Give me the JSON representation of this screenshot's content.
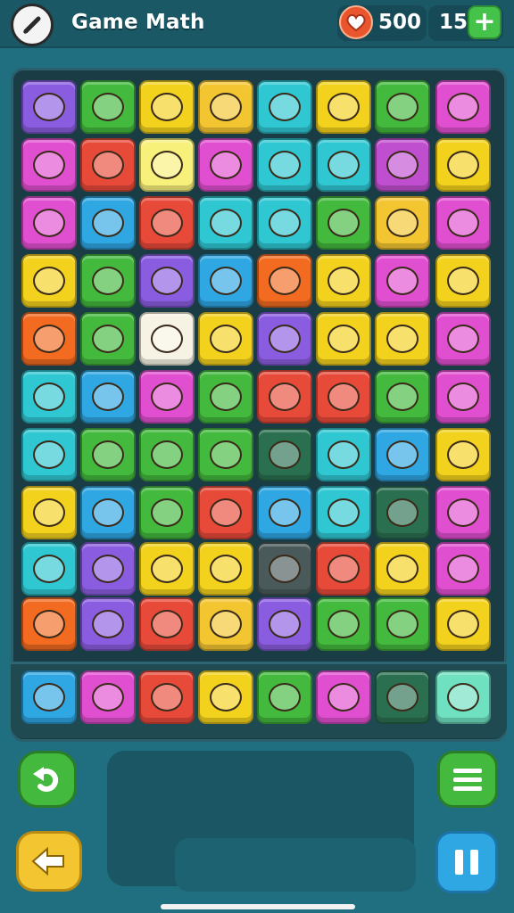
{
  "header": {
    "title": "Game Math",
    "hearts": "500",
    "coins": "15",
    "add_label": "+"
  },
  "colors": {
    "background": "#1f6f80",
    "board": "#1a3c44",
    "accent_green": "#43b93e",
    "accent_yellow": "#f3c531",
    "accent_blue": "#2fa7e3",
    "heart_red": "#e9552c"
  },
  "board": {
    "rows": [
      [
        {
          "color": "#8a5de0",
          "icon": "ghost-face"
        },
        {
          "color": "#43b93e",
          "icon": "leaf"
        },
        {
          "color": "#f3d21e",
          "icon": "star-flower"
        },
        {
          "color": "#f3c531",
          "icon": "sun-face"
        },
        {
          "color": "#2fc7d2",
          "icon": "frog-face"
        },
        {
          "color": "#f3d21e",
          "icon": "smiley"
        },
        {
          "color": "#43b93e",
          "icon": "smiley"
        },
        {
          "color": "#e04fd0",
          "icon": "crab"
        }
      ],
      [
        {
          "color": "#e04fd0",
          "icon": "cake"
        },
        {
          "color": "#e84a3a",
          "icon": "jar"
        },
        {
          "color": "#f7f07a",
          "icon": "ball"
        },
        {
          "color": "#e04fd0",
          "icon": "cup-face"
        },
        {
          "color": "#2fc7d2",
          "icon": "battery"
        },
        {
          "color": "#2fc7d2",
          "icon": "cat-face"
        },
        {
          "color": "#c04fd0",
          "icon": "robot"
        },
        {
          "color": "#f3d21e",
          "icon": "burger"
        }
      ],
      [
        {
          "color": "#e04fd0",
          "icon": "blob"
        },
        {
          "color": "#2fa7e3",
          "icon": "bottle"
        },
        {
          "color": "#e84a3a",
          "icon": "smiley"
        },
        {
          "color": "#2fc7d2",
          "icon": "shield"
        },
        {
          "color": "#2fc7d2",
          "icon": "orange"
        },
        {
          "color": "#43b93e",
          "icon": "tools"
        },
        {
          "color": "#f3c531",
          "icon": "lantern"
        },
        {
          "color": "#e04fd0",
          "icon": "fish"
        }
      ],
      [
        {
          "color": "#f3d21e",
          "icon": "mushroom"
        },
        {
          "color": "#43b93e",
          "icon": "flower"
        },
        {
          "color": "#8a5de0",
          "icon": "orange"
        },
        {
          "color": "#2fa7e3",
          "icon": "wrench"
        },
        {
          "color": "#f26b20",
          "icon": "tomato-face"
        },
        {
          "color": "#f3d21e",
          "icon": "leaf"
        },
        {
          "color": "#e04fd0",
          "icon": "shell"
        },
        {
          "color": "#f3d21e",
          "icon": "ball-face"
        }
      ],
      [
        {
          "color": "#f26b20",
          "icon": "smiley"
        },
        {
          "color": "#43b93e",
          "icon": "cookie"
        },
        {
          "color": "#f7f3e4",
          "icon": "gear-face"
        },
        {
          "color": "#f3d21e",
          "icon": "mouth"
        },
        {
          "color": "#8a5de0",
          "icon": "plum"
        },
        {
          "color": "#f3d21e",
          "icon": "dots"
        },
        {
          "color": "#f3d21e",
          "icon": "onion"
        },
        {
          "color": "#e04fd0",
          "icon": "rock"
        }
      ],
      [
        {
          "color": "#2fc7d2",
          "icon": "hook"
        },
        {
          "color": "#2fa7e3",
          "icon": "shell"
        },
        {
          "color": "#e04fd0",
          "icon": "pizza"
        },
        {
          "color": "#43b93e",
          "icon": "orange"
        },
        {
          "color": "#e84a3a",
          "icon": "speech-bubble"
        },
        {
          "color": "#e84a3a",
          "icon": "bomb"
        },
        {
          "color": "#43b93e",
          "icon": "banana"
        },
        {
          "color": "#e04fd0",
          "icon": "eye"
        }
      ],
      [
        {
          "color": "#2fc7d2",
          "icon": "chick"
        },
        {
          "color": "#43b93e",
          "icon": "bear-face"
        },
        {
          "color": "#43b93e",
          "icon": "snail"
        },
        {
          "color": "#43b93e",
          "icon": "chick"
        },
        {
          "color": "#2a6f50",
          "icon": "pear"
        },
        {
          "color": "#2fc7d2",
          "icon": "apple"
        },
        {
          "color": "#2fa7e3",
          "icon": "potion"
        },
        {
          "color": "#f3d21e",
          "icon": "pipe"
        }
      ],
      [
        {
          "color": "#f3d21e",
          "icon": "castle"
        },
        {
          "color": "#2fa7e3",
          "icon": "sun"
        },
        {
          "color": "#43b93e",
          "icon": "shell"
        },
        {
          "color": "#e84a3a",
          "icon": "pumpkin"
        },
        {
          "color": "#2fa7e3",
          "icon": "bell"
        },
        {
          "color": "#2fc7d2",
          "icon": "fox-face"
        },
        {
          "color": "#2a6f50",
          "icon": "phone"
        },
        {
          "color": "#e04fd0",
          "icon": "unicorn"
        }
      ],
      [
        {
          "color": "#2fc7d2",
          "icon": "cheese"
        },
        {
          "color": "#8a5de0",
          "icon": "rabbit"
        },
        {
          "color": "#f3d21e",
          "icon": "flower-pot"
        },
        {
          "color": "#f3d21e",
          "icon": "corn"
        },
        {
          "color": "#4a5a5a",
          "icon": "peapod"
        },
        {
          "color": "#e84a3a",
          "icon": "leaf"
        },
        {
          "color": "#f3d21e",
          "icon": "pencil"
        },
        {
          "color": "#e04fd0",
          "icon": "crab"
        }
      ],
      [
        {
          "color": "#f26b20",
          "icon": "radio"
        },
        {
          "color": "#8a5de0",
          "icon": "cheese"
        },
        {
          "color": "#e84a3a",
          "icon": "chili"
        },
        {
          "color": "#f3c531",
          "icon": "drop-face"
        },
        {
          "color": "#8a5de0",
          "icon": "pencil"
        },
        {
          "color": "#43b93e",
          "icon": "smiley"
        },
        {
          "color": "#43b93e",
          "icon": "macaron"
        },
        {
          "color": "#f3d21e",
          "icon": "bug-face"
        }
      ]
    ],
    "tray": [
      {
        "color": "#2fa7e3",
        "icon": "heart-shield"
      },
      {
        "color": "#e04fd0",
        "icon": "cross"
      },
      {
        "color": "#e84a3a",
        "icon": "cookie-face"
      },
      {
        "color": "#f3d21e",
        "icon": "fishbowl"
      },
      {
        "color": "#43b93e",
        "icon": "bell"
      },
      {
        "color": "#e04fd0",
        "icon": "speech-bubble"
      },
      {
        "color": "#2a6f50",
        "icon": "ghost"
      },
      {
        "color": "#6fe0c0",
        "icon": "house"
      }
    ]
  },
  "controls": {
    "undo_icon": "undo-icon",
    "back_icon": "arrow-left-icon",
    "menu_icon": "menu-icon",
    "pause_icon": "pause-icon"
  }
}
